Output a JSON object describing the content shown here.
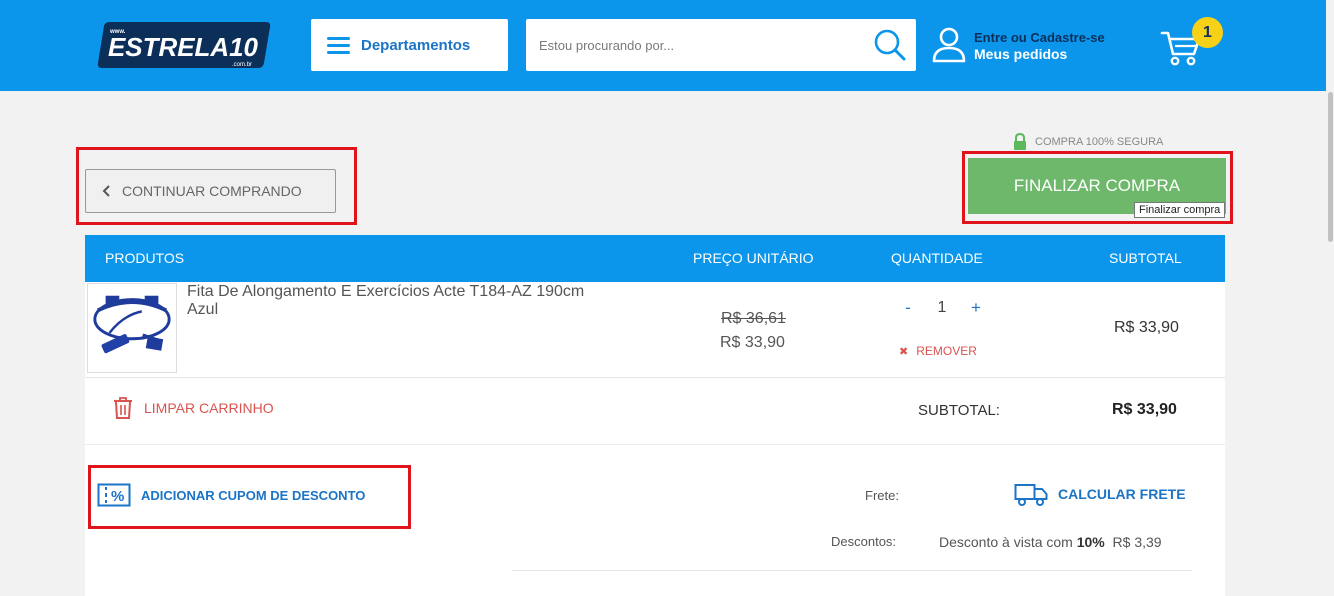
{
  "header": {
    "logo_text": "ESTRELA10",
    "logo_www": "www.",
    "logo_tld": ".com.br",
    "departments_label": "Departamentos",
    "search_placeholder": "Estou procurando por...",
    "account_line1": "Entre ou Cadastre-se",
    "account_line2": "Meus pedidos",
    "cart_count": "1"
  },
  "actions": {
    "continue_label": "CONTINUAR COMPRANDO",
    "secure_label": "COMPRA 100% SEGURA",
    "finalize_label": "FINALIZAR COMPRA",
    "finalize_tooltip": "Finalizar compra"
  },
  "table": {
    "headers": {
      "products": "PRODUTOS",
      "unit_price": "PREÇO UNITÁRIO",
      "quantity": "QUANTIDADE",
      "subtotal": "SUBTOTAL"
    },
    "items": [
      {
        "name": "Fita De Alongamento E Exercícios Acte T184-AZ 190cm Azul",
        "old_price": "R$ 36,61",
        "price": "R$ 33,90",
        "quantity": "1",
        "minus": "-",
        "plus": "+",
        "remove_label": "REMOVER",
        "subtotal": "R$ 33,90"
      }
    ],
    "clear_label": "LIMPAR CARRINHO",
    "subtotal_label": "SUBTOTAL:",
    "subtotal_value": "R$ 33,90"
  },
  "summary": {
    "coupon_label": "ADICIONAR CUPOM DE DESCONTO",
    "frete_label": "Frete:",
    "calc_frete_label": "CALCULAR FRETE",
    "discounts_label": "Descontos:",
    "discount_text": "Desconto à  vista com",
    "discount_pct": "10%",
    "discount_value": "R$ 3,39"
  },
  "colors": {
    "brand_blue": "#0b96ec",
    "navy": "#0c2f5a",
    "finalize_green": "#6db86a",
    "remove_red": "#d9534f",
    "highlight_red": "#e0151b",
    "badge_yellow": "#f7d117"
  }
}
